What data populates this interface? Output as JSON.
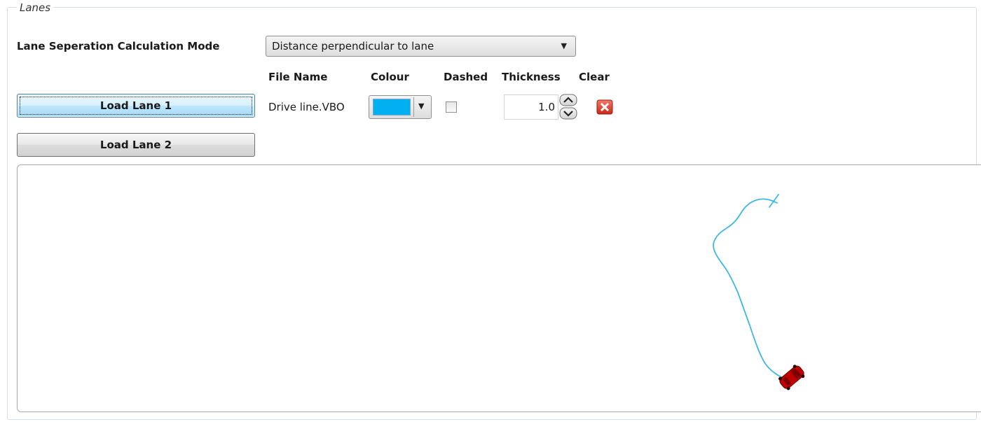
{
  "group": {
    "title": "Lanes"
  },
  "mode": {
    "label": "Lane Seperation Calculation Mode",
    "selected": "Distance perpendicular to lane"
  },
  "columns": {
    "file_name": "File Name",
    "colour": "Colour",
    "dashed": "Dashed",
    "thickness": "Thickness",
    "clear": "Clear"
  },
  "lanes": [
    {
      "button_label": "Load Lane 1",
      "file_name": "Drive line.VBO",
      "colour": "#00b0f0",
      "dashed": false,
      "thickness": "1.0"
    },
    {
      "button_label": "Load Lane 2"
    }
  ],
  "icons": {
    "dropdown": "chevron-down-icon",
    "spin_up": "spin-up-icon",
    "spin_down": "spin-down-icon",
    "clear": "red-x-icon",
    "car": "car-icon"
  },
  "colors": {
    "lane_line": "#3fb8e0",
    "car": "#c00000",
    "focus_button": "#bee6fd"
  }
}
